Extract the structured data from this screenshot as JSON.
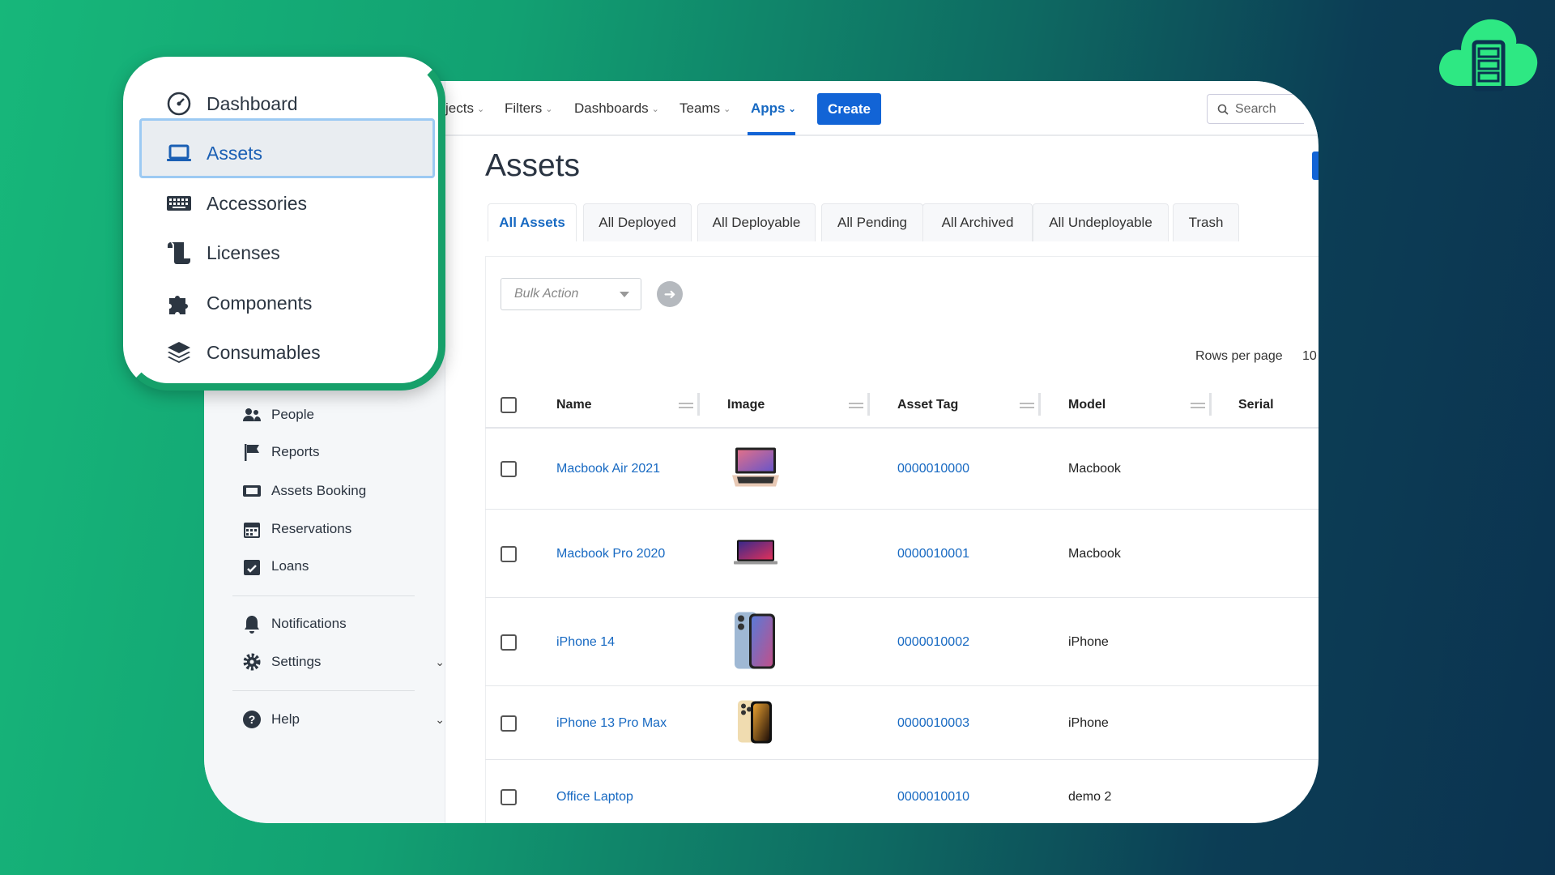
{
  "colors": {
    "accent": "#1264d6",
    "link": "#1769c2",
    "popup_border": "#16a06a",
    "logo": "#2ee883"
  },
  "logo": {
    "icon": "cloud-server-icon"
  },
  "topnav": {
    "items": [
      {
        "label": "jects"
      },
      {
        "label": "Filters"
      },
      {
        "label": "Dashboards"
      },
      {
        "label": "Teams"
      },
      {
        "label": "Apps"
      }
    ],
    "active": "Apps",
    "create_label": "Create",
    "search_placeholder": "Search"
  },
  "popup_menu": {
    "items": [
      {
        "label": "Dashboard",
        "icon": "gauge-icon"
      },
      {
        "label": "Assets",
        "icon": "laptop-icon",
        "selected": true
      },
      {
        "label": "Accessories",
        "icon": "keyboard-icon"
      },
      {
        "label": "Licenses",
        "icon": "scroll-icon"
      },
      {
        "label": "Components",
        "icon": "puzzle-icon"
      },
      {
        "label": "Consumables",
        "icon": "layers-icon"
      }
    ]
  },
  "sidebar": {
    "items": [
      {
        "label": "People",
        "icon": "people-icon"
      },
      {
        "label": "Reports",
        "icon": "flag-icon"
      },
      {
        "label": "Assets Booking",
        "icon": "booking-icon"
      },
      {
        "label": "Reservations",
        "icon": "calendar-icon"
      },
      {
        "label": "Loans",
        "icon": "calendar-check-icon"
      },
      {
        "label": "Notifications",
        "icon": "bell-icon"
      },
      {
        "label": "Settings",
        "icon": "gear-icon"
      },
      {
        "label": "Help",
        "icon": "help-icon"
      }
    ]
  },
  "page": {
    "title": "Assets"
  },
  "tabs": [
    {
      "label": "All Assets",
      "active": true
    },
    {
      "label": "All Deployed"
    },
    {
      "label": "All Deployable"
    },
    {
      "label": "All Pending"
    },
    {
      "label": "All Archived"
    },
    {
      "label": "All Undeployable"
    },
    {
      "label": "Trash"
    }
  ],
  "toolbar": {
    "bulk_placeholder": "Bulk Action",
    "rows_per_page_label": "Rows per page",
    "rows_per_page_value": "10"
  },
  "table": {
    "columns": [
      "Name",
      "Image",
      "Asset Tag",
      "Model",
      "Serial"
    ],
    "rows": [
      {
        "name": "Macbook Air 2021",
        "image": "macbook-air",
        "tag": "0000010000",
        "model": "Macbook"
      },
      {
        "name": "Macbook Pro 2020",
        "image": "macbook-pro",
        "tag": "0000010001",
        "model": "Macbook"
      },
      {
        "name": "iPhone 14",
        "image": "iphone-14",
        "tag": "0000010002",
        "model": "iPhone"
      },
      {
        "name": "iPhone 13 Pro Max",
        "image": "iphone-13",
        "tag": "0000010003",
        "model": "iPhone"
      },
      {
        "name": "Office Laptop",
        "image": "",
        "tag": "0000010010",
        "model": "demo 2"
      }
    ]
  }
}
